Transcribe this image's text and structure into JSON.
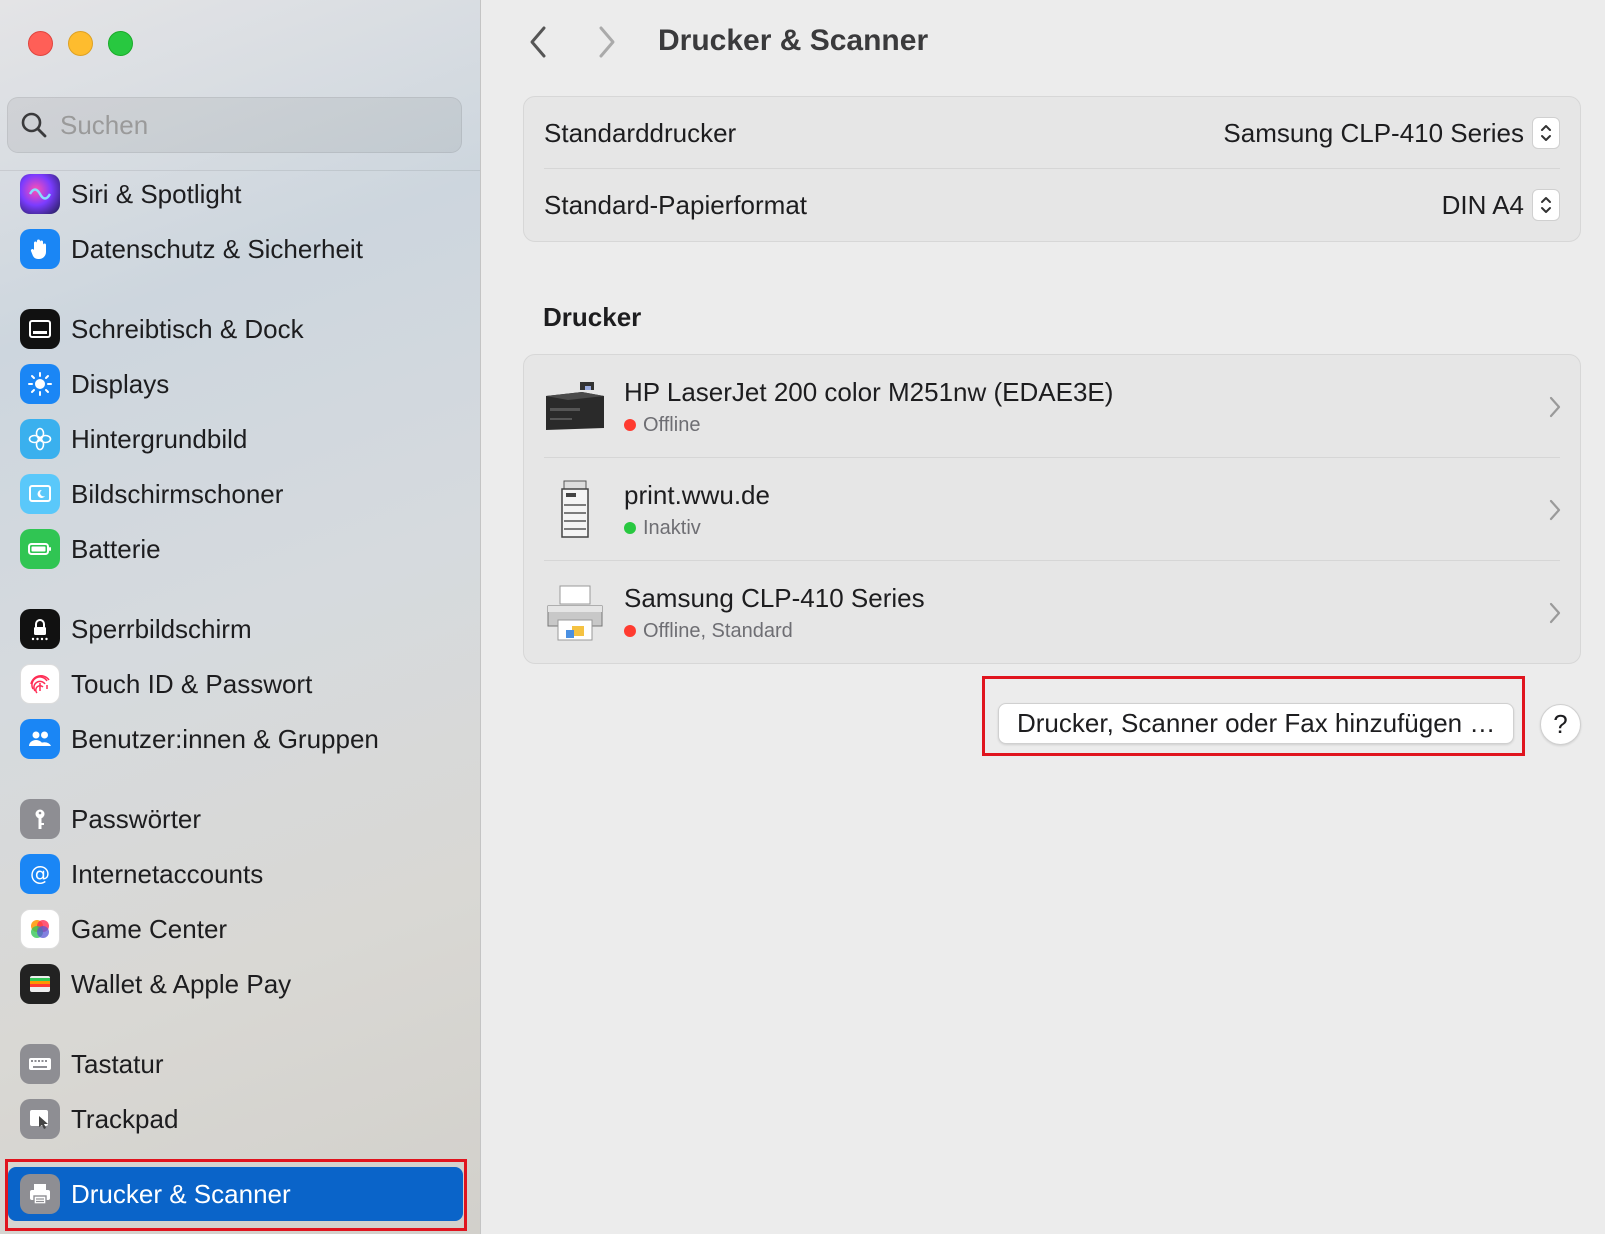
{
  "search": {
    "placeholder": "Suchen"
  },
  "sidebar": {
    "items": [
      {
        "label": "Siri & Spotlight",
        "icon": "siri-icon"
      },
      {
        "label": "Datenschutz & Sicherheit",
        "icon": "hand-icon"
      },
      {
        "label": "Schreibtisch & Dock",
        "icon": "dock-icon"
      },
      {
        "label": "Displays",
        "icon": "sun-icon"
      },
      {
        "label": "Hintergrundbild",
        "icon": "flower-icon"
      },
      {
        "label": "Bildschirmschoner",
        "icon": "screensaver-icon"
      },
      {
        "label": "Batterie",
        "icon": "battery-icon"
      },
      {
        "label": "Sperrbildschirm",
        "icon": "lock-icon"
      },
      {
        "label": "Touch ID & Passwort",
        "icon": "fingerprint-icon"
      },
      {
        "label": "Benutzer:innen & Gruppen",
        "icon": "users-icon"
      },
      {
        "label": "Passwörter",
        "icon": "key-icon"
      },
      {
        "label": "Internetaccounts",
        "icon": "at-icon"
      },
      {
        "label": "Game Center",
        "icon": "game-center-icon"
      },
      {
        "label": "Wallet & Apple Pay",
        "icon": "wallet-icon"
      },
      {
        "label": "Tastatur",
        "icon": "keyboard-icon"
      },
      {
        "label": "Trackpad",
        "icon": "trackpad-icon"
      },
      {
        "label": "Drucker & Scanner",
        "icon": "printer-icon",
        "selected": true
      }
    ]
  },
  "header": {
    "title": "Drucker & Scanner"
  },
  "defaults": {
    "printer_label": "Standarddrucker",
    "printer_value": "Samsung CLP-410 Series",
    "paper_label": "Standard-Papierformat",
    "paper_value": "DIN A4"
  },
  "printers": {
    "heading": "Drucker",
    "list": [
      {
        "name": "HP LaserJet 200 color M251nw (EDAE3E)",
        "status": "Offline",
        "status_color": "#ff3b30"
      },
      {
        "name": "print.wwu.de",
        "status": "Inaktiv",
        "status_color": "#28c840"
      },
      {
        "name": "Samsung CLP-410 Series",
        "status": "Offline, Standard",
        "status_color": "#ff3b30"
      }
    ]
  },
  "actions": {
    "add_label": "Drucker, Scanner oder Fax hinzufügen …",
    "help_label": "?"
  },
  "colors": {
    "selection": "#0a64c9",
    "annotation": "#e0141e"
  }
}
